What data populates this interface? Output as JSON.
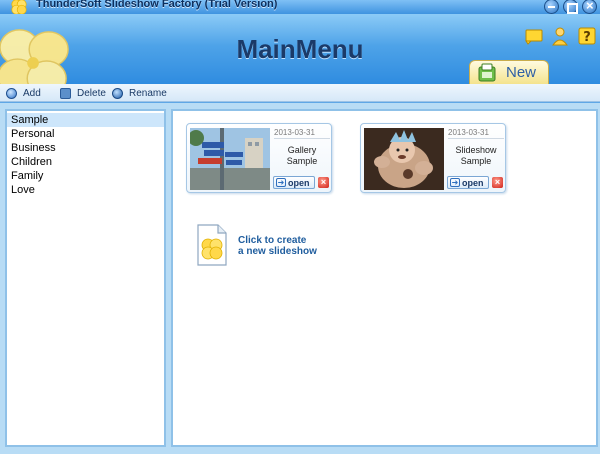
{
  "window": {
    "title": "ThunderSoft Slideshow Factory (Trial Version)"
  },
  "header": {
    "title": "MainMenu",
    "new_label": "New",
    "icons": [
      "message-icon",
      "user-icon",
      "help-icon"
    ]
  },
  "toolbar": {
    "add_label": "Add",
    "delete_label": "Delete",
    "rename_label": "Rename"
  },
  "categories": {
    "selected": "Sample",
    "items": [
      "Sample",
      "Personal",
      "Business",
      "Children",
      "Family",
      "Love"
    ]
  },
  "projects": [
    {
      "date": "2013-03-31",
      "name_line1": "Gallery",
      "name_line2": "Sample",
      "open_label": "open"
    },
    {
      "date": "2013-03-31",
      "name_line1": "Slideshow",
      "name_line2": "Sample",
      "open_label": "open"
    }
  ],
  "create": {
    "line1": "Click to create",
    "line2": "a new slideshow"
  },
  "colors": {
    "title_text": "#1b3a68",
    "accent": "#2f8ce0",
    "link": "#1f5d9e"
  }
}
